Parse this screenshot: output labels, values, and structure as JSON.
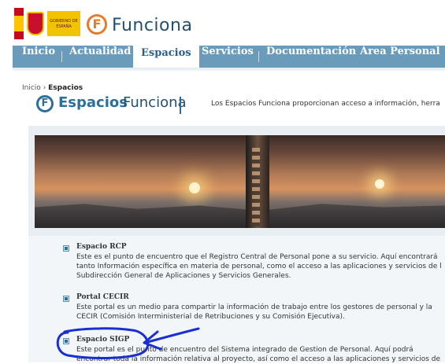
{
  "header": {
    "gov_label": "GOBIERNO DE ESPAÑA",
    "brand": "Funciona",
    "logo_letter": "F"
  },
  "nav": {
    "items": [
      "Inicio",
      "Actualidad",
      "Espacios",
      "Servicios",
      "Documentación",
      "Área Personal"
    ],
    "active": "Espacios"
  },
  "breadcrumb": {
    "home": "Inicio",
    "current": "Espacios"
  },
  "spaces": {
    "logo_bold": "Espacios",
    "logo_light": "Funciona",
    "intro": "Los Espacios Funciona proporcionan acceso a información, herra"
  },
  "entries": [
    {
      "title": "Espacio RCP",
      "lines": [
        "Este es el punto de encuentro que el Registro Central de Personal pone a su servicio. Aquí encontrará",
        "tanto Información específica en materia de personal, como el acceso a las aplicaciones y servicios de l",
        "Subdirección General de Aplicaciones y Servicios Generales."
      ]
    },
    {
      "title": "Portal CECIR",
      "lines": [
        "Este portal es un medio para compartir la información de trabajo entre los gestores de personal y la",
        "CECIR (Comisión Interministerial de Retribuciones y su Comisión Ejecutiva)."
      ]
    },
    {
      "title": "Espacio SIGP",
      "lines": [
        "Este portal es el punto de encuentro del Sistema integrado de Gestion de Personal. Aquí podrá",
        "encontrar toda la información relativa al proyecto, así como el acceso a las aplicaciones y servicios de"
      ]
    }
  ],
  "colors": {
    "nav_bg": "#6a9bbb",
    "brand_blue": "#2d6f98",
    "brand_orange": "#e67c2a",
    "annotation": "#1a2fd0"
  }
}
